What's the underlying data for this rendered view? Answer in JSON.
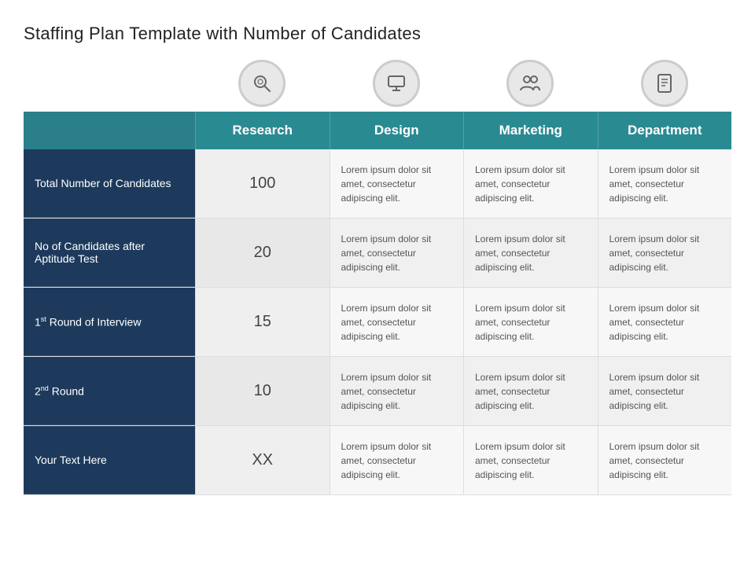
{
  "page": {
    "title": "Staffing Plan Template with Number of Candidates"
  },
  "icons": [
    {
      "name": "search-icon",
      "symbol": "🔍"
    },
    {
      "name": "monitor-icon",
      "symbol": "🖥"
    },
    {
      "name": "marketing-icon",
      "symbol": "👥"
    },
    {
      "name": "document-icon",
      "symbol": "📄"
    }
  ],
  "columns": [
    {
      "label": "Research"
    },
    {
      "label": "Design"
    },
    {
      "label": "Marketing"
    },
    {
      "label": "Department"
    }
  ],
  "rows": [
    {
      "label": "Total Number of Candidates",
      "sup": "",
      "number": "100",
      "cells": [
        "Lorem ipsum dolor sit amet, consectetur adipiscing elit.",
        "Lorem ipsum dolor sit amet, consectetur adipiscing elit.",
        "Lorem ipsum dolor sit amet, consectetur adipiscing elit."
      ]
    },
    {
      "label": "No of Candidates after Aptitude Test",
      "sup": "",
      "number": "20",
      "cells": [
        "Lorem ipsum dolor sit amet, consectetur adipiscing elit.",
        "Lorem ipsum dolor sit amet, consectetur adipiscing elit.",
        "Lorem ipsum dolor sit amet, consectetur adipiscing elit."
      ]
    },
    {
      "label": "1st Round of Interview",
      "sup": "st",
      "labelPrefix": "1",
      "labelSuffix": " Round of Interview",
      "number": "15",
      "cells": [
        "Lorem ipsum dolor sit amet, consectetur adipiscing elit.",
        "Lorem ipsum dolor sit amet, consectetur adipiscing elit.",
        "Lorem ipsum dolor sit amet, consectetur adipiscing elit."
      ]
    },
    {
      "label": "2nd Round",
      "sup": "nd",
      "labelPrefix": "2",
      "labelSuffix": " Round",
      "number": "10",
      "cells": [
        "Lorem ipsum dolor sit amet, consectetur adipiscing elit.",
        "Lorem ipsum dolor sit amet, consectetur adipiscing elit.",
        "Lorem ipsum dolor sit amet, consectetur adipiscing elit."
      ]
    },
    {
      "label": "Your Text Here",
      "sup": "",
      "number": "XX",
      "cells": [
        "Lorem ipsum dolor sit amet, consectetur adipiscing elit.",
        "Lorem ipsum dolor sit amet, consectetur adipiscing elit.",
        "Lorem ipsum dolor sit amet, consectetur adipiscing elit."
      ]
    }
  ]
}
